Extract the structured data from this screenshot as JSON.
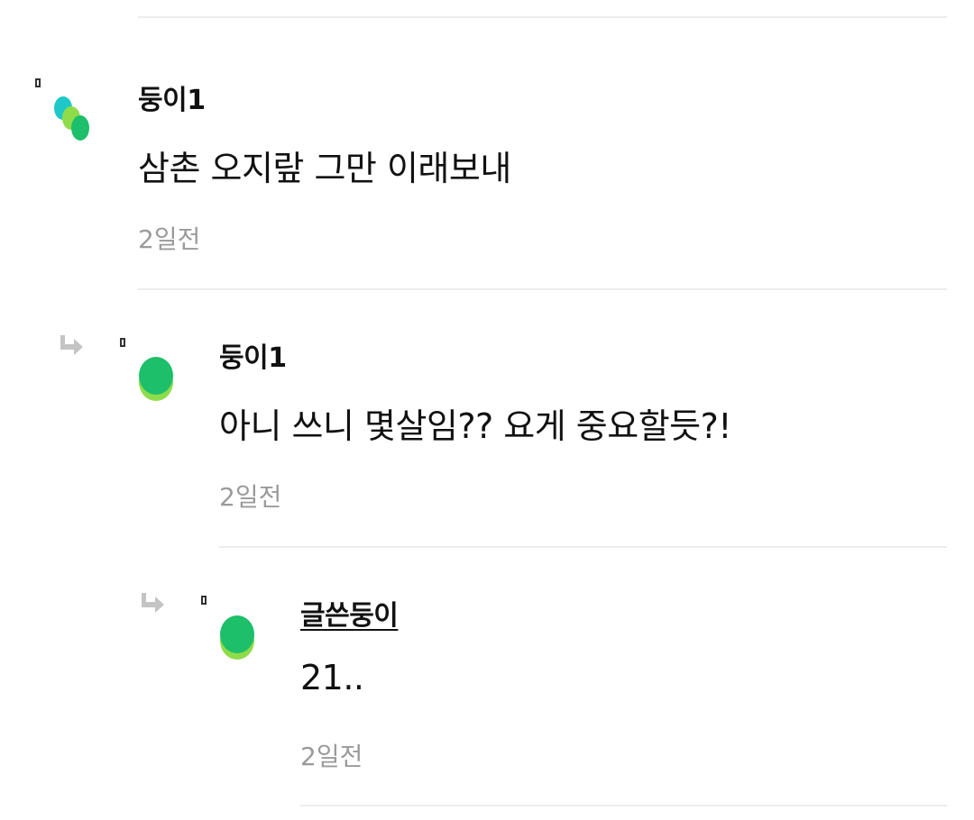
{
  "comments": [
    {
      "author": "둥이1",
      "text": "삼촌 오지랖 그만 이래보내",
      "time": "2일전",
      "avatar_icon": "multicolor-blob-avatar"
    },
    {
      "author": "둥이1",
      "text": "아니 쓰니 몇살임?? 요게 중요할듯?!",
      "time": "2일전",
      "avatar_icon": "green-blob-avatar",
      "is_reply": true
    },
    {
      "author": "글쓴둥이",
      "text": "21..",
      "time": "2일전",
      "avatar_icon": "green-blob-avatar",
      "is_reply": true,
      "is_original_poster": true
    }
  ],
  "colors": {
    "divider": "#ececec",
    "timestamp": "#9a9a9a",
    "arrow": "#c4c4c4",
    "avatar_green": "#1dbf6a",
    "avatar_lime": "#8fdc4a",
    "avatar_cyan": "#1ec8c8"
  }
}
